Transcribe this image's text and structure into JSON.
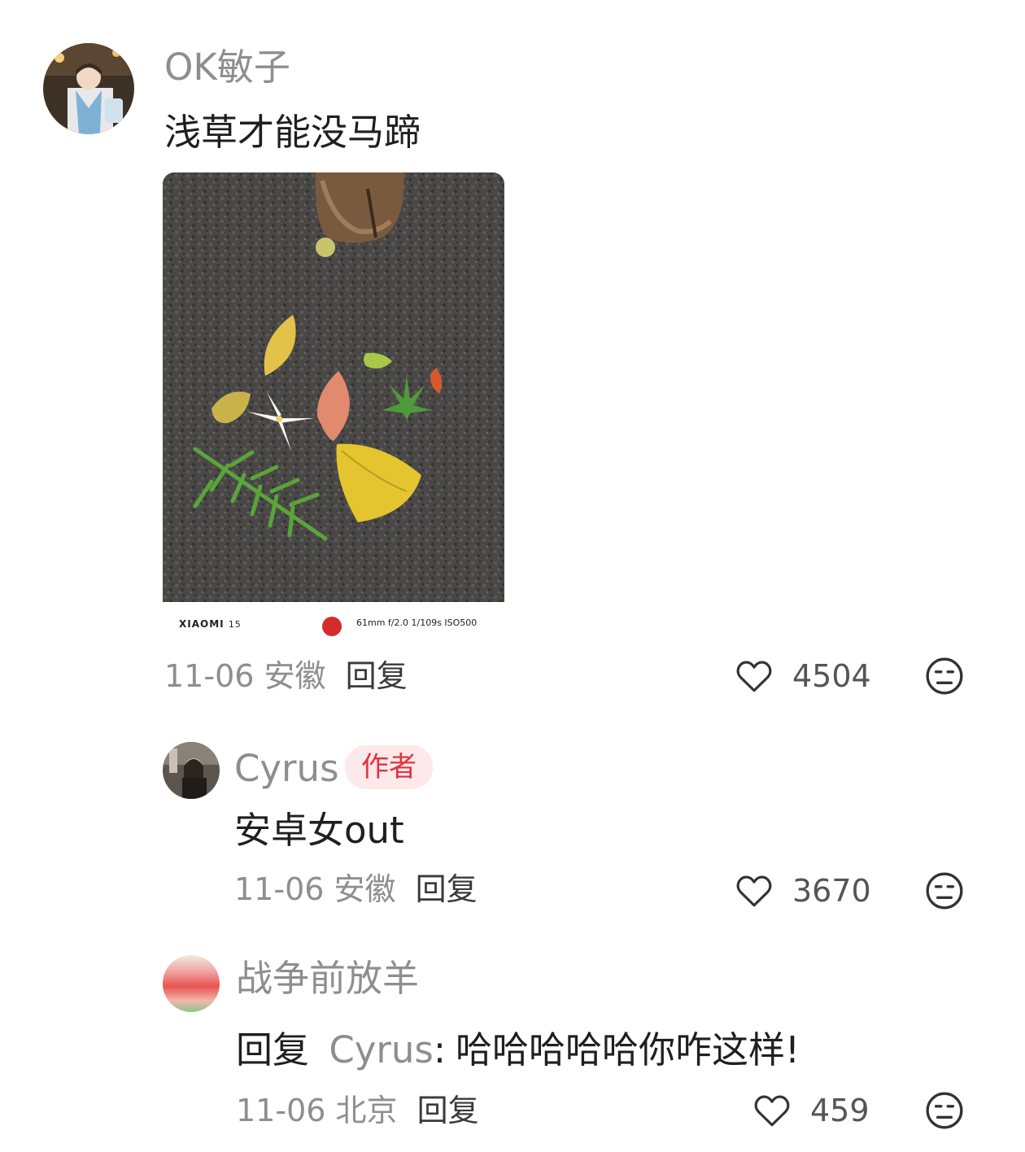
{
  "comments": [
    {
      "user": "OK敏子",
      "text": "浅草才能没马蹄",
      "date": "11-06",
      "location": "安徽",
      "reply_label": "回复",
      "likes": "4504",
      "photo": {
        "brand": "XIAOMI",
        "model": "15",
        "specs": "61mm  f/2.0  1/109s  ISO500"
      }
    },
    {
      "user": "Cyrus",
      "badge": "作者",
      "text": "安卓女out",
      "date": "11-06",
      "location": "安徽",
      "reply_label": "回复",
      "likes": "3670"
    },
    {
      "user": "战争前放羊",
      "reply_prefix": "回复",
      "reply_target": "Cyrus",
      "reply_sep": ":",
      "text": "哈哈哈哈哈你咋这样!",
      "date": "11-06",
      "location": "北京",
      "reply_label": "回复",
      "likes": "459"
    }
  ],
  "colors": {
    "badge_bg": "#fde8ea",
    "badge_text": "#e2323f",
    "muted": "#8e8e8e"
  },
  "icons": [
    "heart-icon",
    "dislike-face-icon"
  ]
}
